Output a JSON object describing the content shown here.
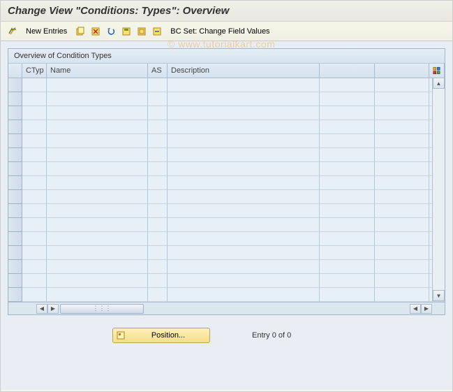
{
  "title": "Change View \"Conditions: Types\": Overview",
  "toolbar": {
    "new_entries_label": "New Entries",
    "bc_set_label": "BC Set: Change Field Values"
  },
  "watermark": "© www.tutorialkart.com",
  "panel": {
    "title": "Overview of Condition Types",
    "columns": {
      "ctyp": "CTyp",
      "name": "Name",
      "as": "AS",
      "description": "Description"
    },
    "rows": [
      {},
      {},
      {},
      {},
      {},
      {},
      {},
      {},
      {},
      {},
      {},
      {},
      {},
      {},
      {},
      {}
    ]
  },
  "footer": {
    "position_label": "Position...",
    "entry_text": "Entry 0 of 0"
  }
}
